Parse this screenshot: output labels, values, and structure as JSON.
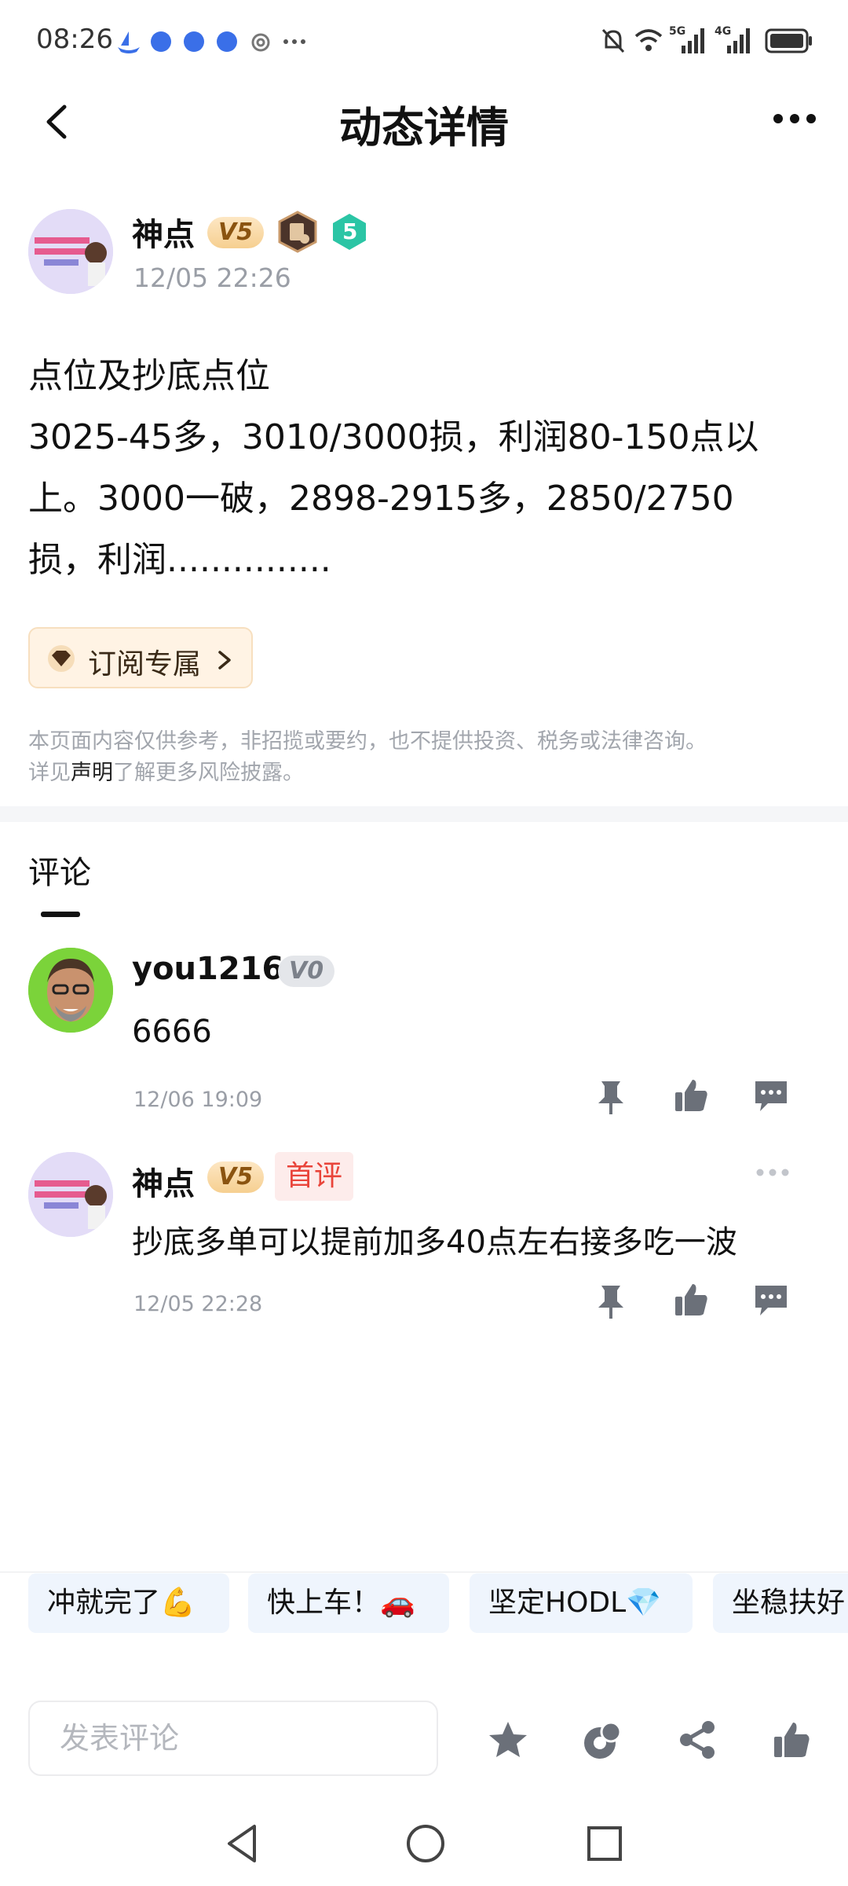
{
  "status_bar": {
    "time": "08:26",
    "signal_5g": "5G",
    "signal_4g": "4G"
  },
  "header": {
    "title": "动态详情"
  },
  "post": {
    "author": "神点",
    "vip_level": "V5",
    "rank_badge": "5",
    "timestamp": "12/05 22:26",
    "lines": [
      "点位及抄底点位",
      "3025-45多，3010/3000损，利润80-150点以",
      "上。3000一破，2898-2915多，2850/2750",
      "损，利润..............."
    ],
    "subscribe_label": "订阅专属"
  },
  "disclaimer": {
    "line1": "本页面内容仅供参考，非招揽或要约，也不提供投资、税务或法律咨询。",
    "prefix": "详见",
    "link": "声明",
    "suffix": "了解更多风险披露。"
  },
  "comments": {
    "title": "评论",
    "items": [
      {
        "user": "you1216",
        "vip_level": "V0",
        "text": "6666",
        "time": "12/06 19:09"
      },
      {
        "user": "神点",
        "vip_level": "V5",
        "badge": "首评",
        "text": "抄底多单可以提前加多40点左右接多吃一波",
        "time": "12/05 22:28"
      }
    ]
  },
  "quick_replies": [
    "冲就完了💪",
    "快上车！🚗",
    "坚定HODL💎",
    "坐稳扶好"
  ],
  "composer": {
    "placeholder": "发表评论"
  },
  "colors": {
    "vip_gold": "#f6cf90",
    "first_badge_red": "#e9443a",
    "icon_gray": "#6b7079",
    "chip_bg": "#eff5fd"
  }
}
